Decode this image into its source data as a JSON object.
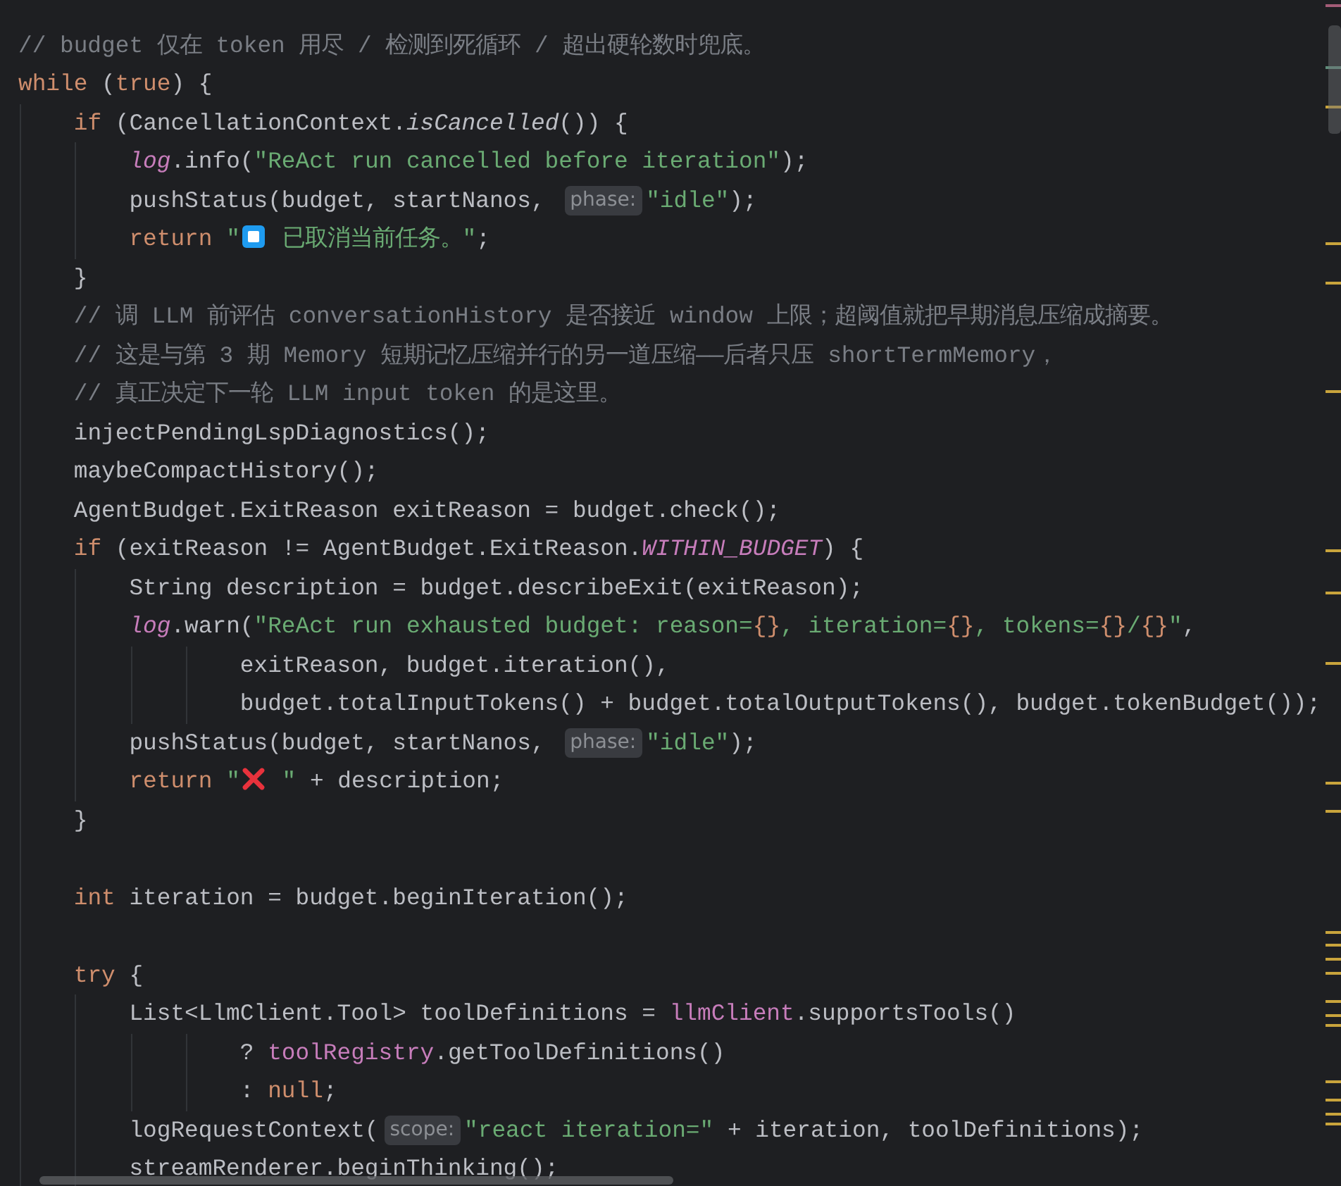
{
  "editor": {
    "lines": [
      {
        "kind": "code",
        "tokens": [
          {
            "kind": "comment",
            "text": "// budget 仅在 token 用尽 / 检测到死循环 / 超出硬轮数时兜底。"
          }
        ]
      },
      {
        "kind": "code",
        "tokens": [
          {
            "kind": "keyword",
            "text": "while"
          },
          {
            "kind": "plain",
            "text": " ("
          },
          {
            "kind": "keyword",
            "text": "true"
          },
          {
            "kind": "plain",
            "text": ") {"
          }
        ]
      },
      {
        "kind": "code",
        "tokens": [
          {
            "kind": "keyword",
            "text": "    if"
          },
          {
            "kind": "plain",
            "text": " (CancellationContext."
          },
          {
            "kind": "static",
            "text": "isCancelled"
          },
          {
            "kind": "plain",
            "text": "()) {"
          }
        ]
      },
      {
        "kind": "code",
        "tokens": [
          {
            "kind": "field",
            "text": "        log"
          },
          {
            "kind": "plain",
            "text": ".info("
          },
          {
            "kind": "string",
            "text": "\"ReAct run cancelled before iteration\""
          },
          {
            "kind": "plain",
            "text": ");"
          }
        ]
      },
      {
        "kind": "code",
        "tokens": [
          {
            "kind": "plain",
            "text": "        pushStatus(budget, startNanos, "
          },
          {
            "kind": "hint",
            "text": "phase:"
          },
          {
            "kind": "string",
            "text": "\"idle\""
          },
          {
            "kind": "plain",
            "text": ");"
          }
        ]
      },
      {
        "kind": "code",
        "tokens": [
          {
            "kind": "keyword",
            "text": "        return"
          },
          {
            "kind": "string",
            "text": " \""
          },
          {
            "kind": "stop"
          },
          {
            "kind": "string",
            "text": " 已取消当前任务。\""
          },
          {
            "kind": "plain",
            "text": ";"
          }
        ]
      },
      {
        "kind": "code",
        "tokens": [
          {
            "kind": "plain",
            "text": "    }"
          }
        ]
      },
      {
        "kind": "code",
        "tokens": [
          {
            "kind": "comment",
            "text": "    // 调 LLM 前评估 conversationHistory 是否接近 window 上限；超阈值就把早期消息压缩成摘要。"
          }
        ]
      },
      {
        "kind": "code",
        "tokens": [
          {
            "kind": "comment",
            "text": "    // 这是与第 3 期 Memory 短期记忆压缩并行的另一道压缩——后者只压 shortTermMemory，"
          }
        ]
      },
      {
        "kind": "code",
        "tokens": [
          {
            "kind": "comment",
            "text": "    // 真正决定下一轮 LLM input token 的是这里。"
          }
        ]
      },
      {
        "kind": "code",
        "tokens": [
          {
            "kind": "plain",
            "text": "    injectPendingLspDiagnostics();"
          }
        ]
      },
      {
        "kind": "code",
        "tokens": [
          {
            "kind": "plain",
            "text": "    maybeCompactHistory();"
          }
        ]
      },
      {
        "kind": "code",
        "tokens": [
          {
            "kind": "plain",
            "text": "    AgentBudget.ExitReason exitReason = budget.check();"
          }
        ]
      },
      {
        "kind": "code",
        "tokens": [
          {
            "kind": "keyword",
            "text": "    if"
          },
          {
            "kind": "plain",
            "text": " (exitReason != AgentBudget.ExitReason."
          },
          {
            "kind": "field",
            "text": "WITHIN_BUDGET"
          },
          {
            "kind": "plain",
            "text": ") {"
          }
        ]
      },
      {
        "kind": "code",
        "tokens": [
          {
            "kind": "plain",
            "text": "        String description = budget.describeExit(exitReason);"
          }
        ]
      },
      {
        "kind": "code",
        "tokens": [
          {
            "kind": "field",
            "text": "        log"
          },
          {
            "kind": "plain",
            "text": ".warn("
          },
          {
            "kind": "string",
            "text": "\"ReAct run exhausted budget: reason="
          },
          {
            "kind": "format",
            "text": "{}"
          },
          {
            "kind": "string",
            "text": ", iteration="
          },
          {
            "kind": "format",
            "text": "{}"
          },
          {
            "kind": "string",
            "text": ", tokens="
          },
          {
            "kind": "format",
            "text": "{}"
          },
          {
            "kind": "string",
            "text": "/"
          },
          {
            "kind": "format",
            "text": "{}"
          },
          {
            "kind": "string",
            "text": "\""
          },
          {
            "kind": "plain",
            "text": ","
          }
        ]
      },
      {
        "kind": "code",
        "tokens": [
          {
            "kind": "plain",
            "text": "                exitReason, budget.iteration(),"
          }
        ]
      },
      {
        "kind": "code",
        "tokens": [
          {
            "kind": "plain",
            "text": "                budget.totalInputTokens() + budget.totalOutputTokens(), budget.tokenBudget());"
          }
        ]
      },
      {
        "kind": "code",
        "tokens": [
          {
            "kind": "plain",
            "text": "        pushStatus(budget, startNanos, "
          },
          {
            "kind": "hint",
            "text": "phase:"
          },
          {
            "kind": "string",
            "text": "\"idle\""
          },
          {
            "kind": "plain",
            "text": ");"
          }
        ]
      },
      {
        "kind": "code",
        "tokens": [
          {
            "kind": "keyword",
            "text": "        return"
          },
          {
            "kind": "string",
            "text": " \""
          },
          {
            "kind": "cross"
          },
          {
            "kind": "string",
            "text": " \""
          },
          {
            "kind": "plain",
            "text": " + description;"
          }
        ]
      },
      {
        "kind": "code",
        "tokens": [
          {
            "kind": "plain",
            "text": "    }"
          }
        ]
      },
      {
        "kind": "blank"
      },
      {
        "kind": "code",
        "tokens": [
          {
            "kind": "keyword",
            "text": "    int"
          },
          {
            "kind": "plain",
            "text": " iteration = budget.beginIteration();"
          }
        ]
      },
      {
        "kind": "blank"
      },
      {
        "kind": "code",
        "tokens": [
          {
            "kind": "keyword",
            "text": "    try"
          },
          {
            "kind": "plain",
            "text": " {"
          }
        ]
      },
      {
        "kind": "code",
        "tokens": [
          {
            "kind": "plain",
            "text": "        List<LlmClient.Tool> toolDefinitions = "
          },
          {
            "kind": "member",
            "text": "llmClient"
          },
          {
            "kind": "plain",
            "text": ".supportsTools()"
          }
        ]
      },
      {
        "kind": "code",
        "tokens": [
          {
            "kind": "plain",
            "text": "                ? "
          },
          {
            "kind": "member",
            "text": "toolRegistry"
          },
          {
            "kind": "plain",
            "text": ".getToolDefinitions()"
          }
        ]
      },
      {
        "kind": "code",
        "tokens": [
          {
            "kind": "plain",
            "text": "                : "
          },
          {
            "kind": "keyword",
            "text": "null"
          },
          {
            "kind": "plain",
            "text": ";"
          }
        ]
      },
      {
        "kind": "code",
        "tokens": [
          {
            "kind": "plain",
            "text": "        logRequestContext("
          },
          {
            "kind": "hint",
            "text": "scope:"
          },
          {
            "kind": "string",
            "text": "\"react iteration=\""
          },
          {
            "kind": "plain",
            "text": " + iteration, toolDefinitions);"
          }
        ]
      },
      {
        "kind": "code",
        "tokens": [
          {
            "kind": "plain",
            "text": "        streamRenderer.beginThinking();"
          }
        ]
      }
    ]
  }
}
